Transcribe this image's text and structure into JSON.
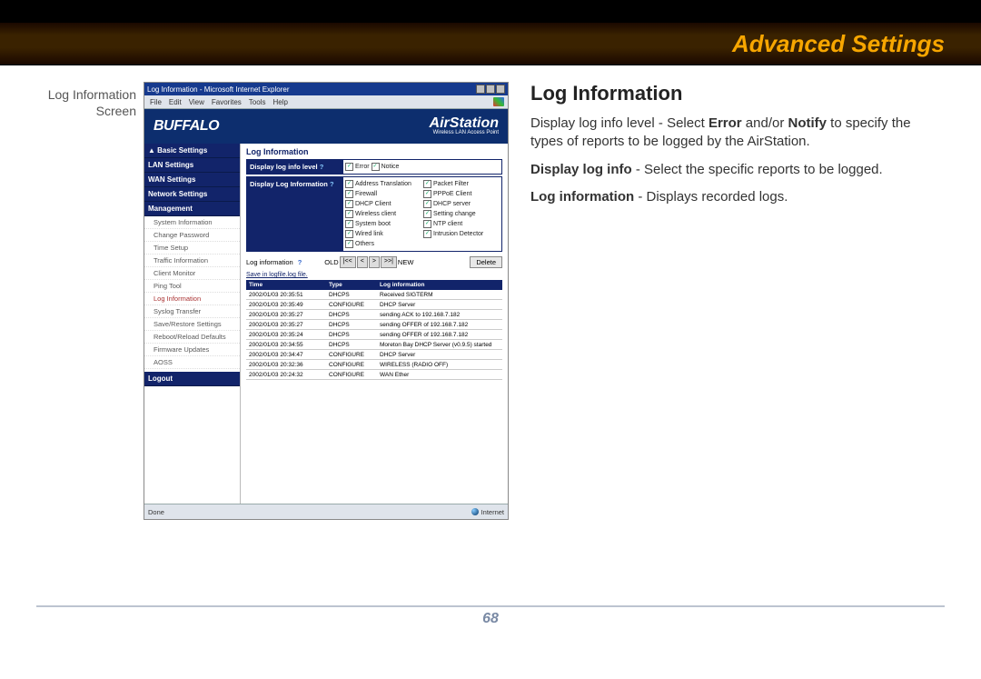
{
  "page_header": "Advanced Settings",
  "caption": "Log Information Screen",
  "page_number": "68",
  "article": {
    "title": "Log Information",
    "p1_pre": "Display log info level - Select ",
    "p1_b1": "Error",
    "p1_mid": " and/or ",
    "p1_b2": "Notify",
    "p1_post": " to spec­ify the types of reports to be logged by the AirStation.",
    "p2_b": "Display log info",
    "p2_post": " - Select the specific reports to be logged.",
    "p3_b": "Log information",
    "p3_post": " - Displays recorded logs."
  },
  "shot": {
    "titlebar": "Log Information - Microsoft Internet Explorer",
    "menus": [
      "File",
      "Edit",
      "View",
      "Favorites",
      "Tools",
      "Help"
    ],
    "brand_left": "BUFFALO",
    "brand_right_top": "AirStation",
    "brand_right_sub": "Wireless LAN Access Point",
    "sidebar": {
      "top": "▲ Basic Settings",
      "sections": [
        "LAN Settings",
        "WAN Settings",
        "Network Settings",
        "Management"
      ],
      "subs": [
        "System Information",
        "Change Password",
        "Time Setup",
        "Traffic Information",
        "Client Monitor",
        "Ping Tool",
        "Log Information",
        "Syslog Transfer",
        "Save/Restore Settings",
        "Reboot/Reload Defaults",
        "Firmware Updates",
        "AOSS"
      ],
      "logout": "Logout"
    },
    "main_title": "Log Information",
    "cfg1_label": "Display log info level",
    "cfg1_items": [
      "Error",
      "Notice"
    ],
    "cfg2_label": "Display Log Information",
    "cfg2_items": [
      [
        "Address Translation",
        "Packet Filter"
      ],
      [
        "Firewall",
        "PPPoE Client"
      ],
      [
        "DHCP Client",
        "DHCP server"
      ],
      [
        "Wireless client",
        "Setting change"
      ],
      [
        "System boot",
        "NTP client"
      ],
      [
        "Wired link",
        "Intrusion Detector"
      ],
      [
        "Others",
        ""
      ]
    ],
    "logbar_label": "Log information",
    "save_link": "Save in logfile.log file.",
    "pager_old": "OLD",
    "pager_new": "NEW",
    "pager_btns": [
      "|<<",
      "<",
      ">",
      ">>|"
    ],
    "delete_btn": "Delete",
    "table_headers": [
      "Time",
      "Type",
      "Log information"
    ],
    "rows": [
      [
        "2002/01/03 20:35:51",
        "DHCPS",
        "Received SIGTERM"
      ],
      [
        "2002/01/03 20:35:49",
        "CONFIGURE",
        "DHCP Server"
      ],
      [
        "2002/01/03 20:35:27",
        "DHCPS",
        "sending ACK to 192.168.7.182"
      ],
      [
        "2002/01/03 20:35:27",
        "DHCPS",
        "sending OFFER of 192.168.7.182"
      ],
      [
        "2002/01/03 20:35:24",
        "DHCPS",
        "sending OFFER of 192.168.7.182"
      ],
      [
        "2002/01/03 20:34:55",
        "DHCPS",
        "Moreton Bay DHCP Server (v0.9.5) started"
      ],
      [
        "2002/01/03 20:34:47",
        "CONFIGURE",
        "DHCP Server"
      ],
      [
        "2002/01/03 20:32:36",
        "CONFIGURE",
        "WIRELESS (RADIO OFF)"
      ],
      [
        "2002/01/03 20:24:32",
        "CONFIGURE",
        "WAN Ether"
      ]
    ],
    "status_done": "Done",
    "status_zone": "Internet"
  }
}
